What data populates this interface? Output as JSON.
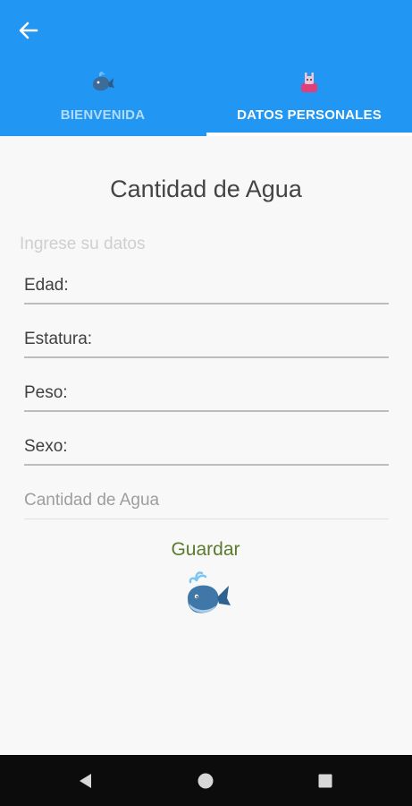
{
  "colors": {
    "appbar": "#2196f3",
    "tab_inactive": "#b3dcfb",
    "tab_active": "#ffffff",
    "save_text": "#5b7a2e",
    "navbar": "#0c0c0c"
  },
  "appbar": {
    "back_icon": "arrow-left-icon",
    "tabs": [
      {
        "label": "BIENVENIDA",
        "icon": "whale-icon",
        "selected": false
      },
      {
        "label": "DATOS PERSONALES",
        "icon": "person-icon",
        "selected": true
      }
    ]
  },
  "main": {
    "title": "Cantidad de Agua",
    "hint": "Ingrese su datos",
    "fields": [
      {
        "text": "Edad:"
      },
      {
        "text": "Estatura:"
      },
      {
        "text": "Peso:"
      },
      {
        "text": "Sexo:"
      },
      {
        "text": "Cantidad de Agua"
      }
    ],
    "save_label": "Guardar",
    "whale_icon": "whale-icon"
  },
  "navbar": {
    "back_icon": "triangle-back-icon",
    "home_icon": "circle-home-icon",
    "recents_icon": "square-recents-icon"
  }
}
